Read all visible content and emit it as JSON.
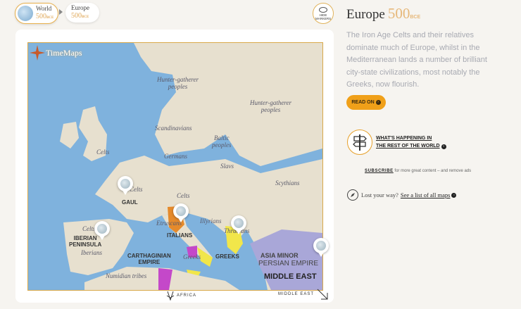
{
  "breadcrumb": {
    "world": {
      "name": "World",
      "year": "500",
      "era": "BCE"
    },
    "europe": {
      "name": "Europe",
      "year": "500",
      "era": "BCE"
    }
  },
  "hide_markers": {
    "label_line1": "HIDE",
    "label_line2": "MARKERS",
    "icon": "eye-off-icon"
  },
  "map": {
    "logo": "TimeMaps",
    "peoples": [
      {
        "id": "hunter-1",
        "text": "Hunter-gatherer\npeoples"
      },
      {
        "id": "hunter-2",
        "text": "Hunter-gatherer\npeoples"
      },
      {
        "id": "scandinavians",
        "text": "Scandinavians"
      },
      {
        "id": "baltic",
        "text": "Baltic\npeoples"
      },
      {
        "id": "celts-north",
        "text": "Celts"
      },
      {
        "id": "germans",
        "text": "Germans"
      },
      {
        "id": "slavs",
        "text": "Slavs"
      },
      {
        "id": "scythians",
        "text": "Scythians"
      },
      {
        "id": "celts-gaul",
        "text": "Celts"
      },
      {
        "id": "celts-central",
        "text": "Celts"
      },
      {
        "id": "illyrians",
        "text": "Illyrians"
      },
      {
        "id": "thracians",
        "text": "Thracians"
      },
      {
        "id": "celts-iberia",
        "text": "Celts"
      },
      {
        "id": "iberians",
        "text": "Iberians"
      },
      {
        "id": "etruscans",
        "text": "Etruscans"
      },
      {
        "id": "greeks-italy",
        "text": "Greeks"
      },
      {
        "id": "numidian",
        "text": "Numidian tribes"
      }
    ],
    "states": [
      {
        "id": "gaul",
        "text": "GAUL"
      },
      {
        "id": "iberian",
        "text": "IBERIAN\nPENINSULA"
      },
      {
        "id": "italians",
        "text": "ITALIANS"
      },
      {
        "id": "carthaginian",
        "text": "CARTHAGINIAN\nEMPIRE"
      },
      {
        "id": "greeks",
        "text": "GREEKS"
      }
    ],
    "persia": {
      "asia_minor": "ASIA MINOR",
      "persian_empire": "PERSIAN EMPIRE",
      "middle_east": "MIDDLE EAST"
    },
    "colors": {
      "sea": "#7fb2dd",
      "land": "#e7e0cf",
      "etruscan": "#e58a2b",
      "greek": "#f1e64a",
      "carthage": "#c448c9",
      "persia": "#a9a7d8"
    }
  },
  "nav": {
    "africa": "AFRICA",
    "middle_east": "MIDDLE EAST"
  },
  "sidebar": {
    "title": "Europe",
    "year": "500",
    "era": "BCE",
    "intro": "The Iron Age Celts and their relatives dominate much of Europe, whilst in the Mediterranean lands a number of brilliant city-state civilizations, most notably the Greeks, now flourish.",
    "read_on": "READ ON",
    "whats_line1": "WHAT'S HAPPENING IN",
    "whats_line2": "THE REST OF THE WORLD",
    "subscribe_link": "SUBSCRIBE",
    "subscribe_rest": " for more great content – and remove ads",
    "lost_text": "Lost your way?",
    "lost_link": "See a list of all maps"
  }
}
